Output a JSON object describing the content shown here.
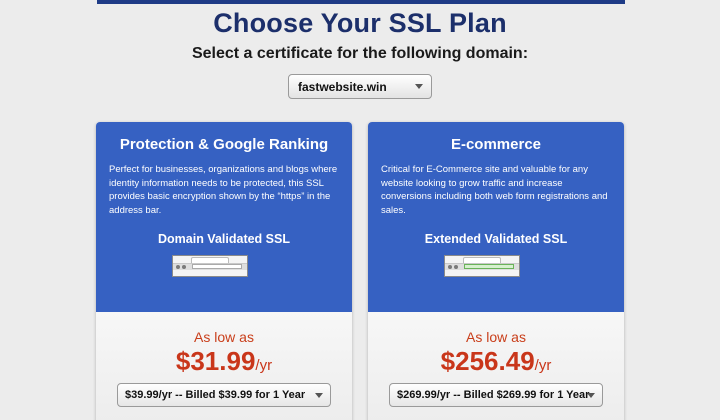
{
  "page": {
    "heading": "Choose Your SSL Plan",
    "subheading": "Select a certificate for the following domain:"
  },
  "domain_select": {
    "value": "fastwebsite.win"
  },
  "plans": [
    {
      "title": "Protection & Google Ranking",
      "description": "Perfect for businesses, organizations and blogs where identity information needs to be protected, this SSL provides basic encryption shown by the “https” in the address bar.",
      "cert_name": "Domain Validated SSL",
      "as_low_as": "As low as",
      "price": "$31.99",
      "per": "/yr",
      "billing_option": "$39.99/yr -- Billed $39.99 for 1 Year",
      "browser_icon": "browser-address-bar-icon"
    },
    {
      "title": "E-commerce",
      "description": "Critical for E-Commerce site and valuable for any website looking to grow traffic and increase conversions including both web form registrations and sales.",
      "cert_name": "Extended Validated SSL",
      "as_low_as": "As low as",
      "price": "$256.49",
      "per": "/yr",
      "billing_option": "$269.99/yr -- Billed $269.99 for 1 Year",
      "browser_icon": "browser-green-address-bar-icon"
    }
  ],
  "colors": {
    "heading": "#1c2f6b",
    "card_header": "#3661c2",
    "price": "#c9361a",
    "green_bar": "#6ab35a"
  }
}
